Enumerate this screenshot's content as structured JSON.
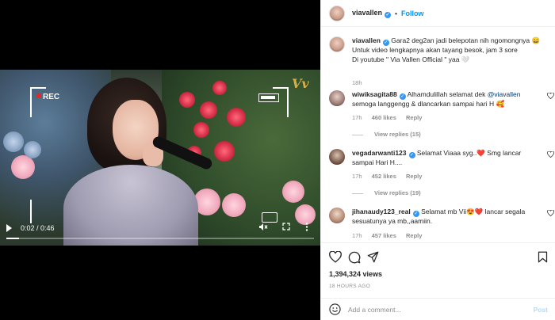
{
  "video": {
    "rec_label": "REC",
    "logo_text": "Vv",
    "time": "0:02 / 0:46",
    "progress": 0.04
  },
  "header": {
    "username": "viavallen",
    "separator": "•",
    "follow_label": "Follow"
  },
  "caption": {
    "username": "viavallen",
    "lines": [
      "Gara2 deg2an jadi belepotan nih ngomongnya 😄",
      "Untuk video lengkapnya akan tayang besok, jam 3 sore",
      "Di youtube \" Via Vallen Official \" yaa 🤍"
    ],
    "time": "18h"
  },
  "comments": [
    {
      "username": "wiwiksagita88",
      "text_before": "Alhamdulillah selamat dek ",
      "mention": "@viavallen",
      "text_after": "semoga langgengg & dlancarkan sampai hari H 🥰",
      "time": "17h",
      "likes": "460 likes",
      "reply": "Reply",
      "view_replies": "View replies (15)"
    },
    {
      "username": "vegadarwanti123",
      "text_before": "Selamat Viaaa syg..❤️ Smg lancar",
      "mention": "",
      "text_after": "sampai Hari H....",
      "time": "17h",
      "likes": "452 likes",
      "reply": "Reply",
      "view_replies": "View replies (19)"
    },
    {
      "username": "jihanaudy123_real",
      "text_before": "Selamat mb Vii😍❤️ lancar segala",
      "mention": "",
      "text_after": "sesuatunya ya mb,,aamiin.",
      "time": "17h",
      "likes": "457 likes",
      "reply": "Reply",
      "view_replies": ""
    }
  ],
  "stats": {
    "views": "1,394,324 views",
    "ago": "18 HOURS AGO"
  },
  "comment_box": {
    "placeholder": "Add a comment...",
    "post_label": "Post"
  },
  "colors": {
    "accent": "#0095f6",
    "verified": "#3897f0",
    "muted": "#8e8e8e",
    "post_disabled": "#b3dbff"
  }
}
